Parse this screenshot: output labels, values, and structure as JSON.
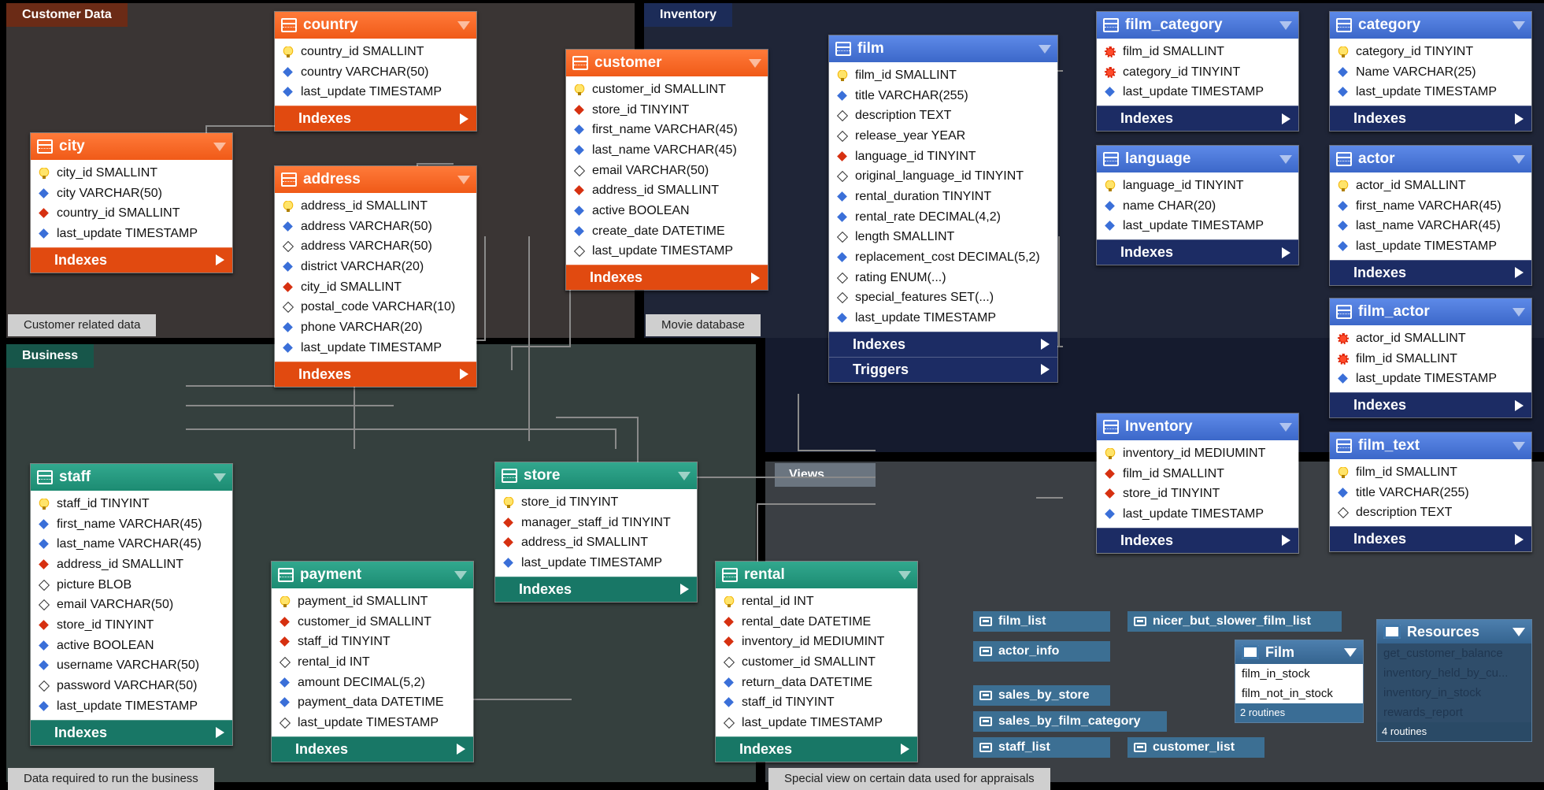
{
  "regions": {
    "customer": {
      "title": "Customer Data",
      "caption": "Customer related data"
    },
    "inventory": {
      "title": "Inventory",
      "caption": "Movie database"
    },
    "business": {
      "title": "Business",
      "caption": "Data required to run the business"
    },
    "views": {
      "title": "Views",
      "caption": "Special view on certain data used for appraisals"
    }
  },
  "tables": {
    "country": {
      "name": "country",
      "columns": [
        "country_id SMALLINT",
        "country VARCHAR(50)",
        "last_update TIMESTAMP"
      ],
      "sections": [
        "Indexes"
      ]
    },
    "city": {
      "name": "city",
      "columns": [
        "city_id SMALLINT",
        "city VARCHAR(50)",
        "country_id SMALLINT",
        "last_update TIMESTAMP"
      ],
      "sections": [
        "Indexes"
      ]
    },
    "address": {
      "name": "address",
      "columns": [
        "address_id SMALLINT",
        "address VARCHAR(50)",
        "address VARCHAR(50)",
        "district VARCHAR(20)",
        "city_id SMALLINT",
        "postal_code VARCHAR(10)",
        "phone VARCHAR(20)",
        "last_update TIMESTAMP"
      ],
      "sections": [
        "Indexes"
      ]
    },
    "customer": {
      "name": "customer",
      "columns": [
        "customer_id SMALLINT",
        "store_id TINYINT",
        "first_name VARCHAR(45)",
        "last_name VARCHAR(45)",
        "email VARCHAR(50)",
        "address_id SMALLINT",
        "active BOOLEAN",
        "create_date DATETIME",
        "last_update TIMESTAMP"
      ],
      "sections": [
        "Indexes"
      ]
    },
    "film": {
      "name": "film",
      "columns": [
        "film_id SMALLINT",
        "title VARCHAR(255)",
        "description TEXT",
        "release_year YEAR",
        "language_id TINYINT",
        "original_language_id TINYINT",
        "rental_duration TINYINT",
        "rental_rate DECIMAL(4,2)",
        "length SMALLINT",
        "replacement_cost DECIMAL(5,2)",
        "rating ENUM(...)",
        "special_features SET(...)",
        "last_update TIMESTAMP"
      ],
      "sections": [
        "Indexes",
        "Triggers"
      ]
    },
    "film_category": {
      "name": "film_category",
      "columns": [
        "film_id SMALLINT",
        "category_id TINYINT",
        "last_update TIMESTAMP"
      ],
      "sections": [
        "Indexes"
      ]
    },
    "category": {
      "name": "category",
      "columns": [
        "category_id TINYINT",
        "Name VARCHAR(25)",
        "last_update TIMESTAMP"
      ],
      "sections": [
        "Indexes"
      ]
    },
    "language": {
      "name": "language",
      "columns": [
        "language_id TINYINT",
        "name CHAR(20)",
        "last_update TIMESTAMP"
      ],
      "sections": [
        "Indexes"
      ]
    },
    "actor": {
      "name": "actor",
      "columns": [
        "actor_id SMALLINT",
        "first_name VARCHAR(45)",
        "last_name VARCHAR(45)",
        "last_update TIMESTAMP"
      ],
      "sections": [
        "Indexes"
      ]
    },
    "film_actor": {
      "name": "film_actor",
      "columns": [
        "actor_id SMALLINT",
        "film_id SMALLINT",
        "last_update TIMESTAMP"
      ],
      "sections": [
        "Indexes"
      ]
    },
    "inventory": {
      "name": "Inventory",
      "columns": [
        "inventory_id MEDIUMINT",
        "film_id SMALLINT",
        "store_id TINYINT",
        "last_update TIMESTAMP"
      ],
      "sections": [
        "Indexes"
      ]
    },
    "film_text": {
      "name": "film_text",
      "columns": [
        "film_id SMALLINT",
        "title VARCHAR(255)",
        "description TEXT"
      ],
      "sections": [
        "Indexes"
      ]
    },
    "staff": {
      "name": "staff",
      "columns": [
        "staff_id TINYINT",
        "first_name VARCHAR(45)",
        "last_name VARCHAR(45)",
        "address_id SMALLINT",
        "picture BLOB",
        "email VARCHAR(50)",
        "store_id TINYINT",
        "active BOOLEAN",
        "username VARCHAR(50)",
        "password VARCHAR(50)",
        "last_update TIMESTAMP"
      ],
      "sections": [
        "Indexes"
      ]
    },
    "store": {
      "name": "store",
      "columns": [
        "store_id TINYINT",
        "manager_staff_id TINYINT",
        "address_id SMALLINT",
        "last_update TIMESTAMP"
      ],
      "sections": [
        "Indexes"
      ]
    },
    "payment": {
      "name": "payment",
      "columns": [
        "payment_id SMALLINT",
        "customer_id SMALLINT",
        "staff_id TINYINT",
        "rental_id INT",
        "amount DECIMAL(5,2)",
        "payment_data DATETIME",
        "last_update TIMESTAMP"
      ],
      "sections": [
        "Indexes"
      ]
    },
    "rental": {
      "name": "rental",
      "columns": [
        "rental_id INT",
        "rental_date DATETIME",
        "inventory_id MEDIUMINT",
        "customer_id SMALLINT",
        "return_data DATETIME",
        "staff_id TINYINT",
        "last_update TIMESTAMP"
      ],
      "sections": [
        "Indexes"
      ]
    }
  },
  "views": [
    "film_list",
    "nicer_but_slower_film_list",
    "actor_info",
    "sales_by_store",
    "sales_by_film_category",
    "staff_list",
    "customer_list"
  ],
  "groups": {
    "film": {
      "name": "Film",
      "routines": [
        "film_in_stock",
        "film_not_in_stock"
      ],
      "count": "2 routines"
    },
    "resources": {
      "name": "Resources",
      "routines": [
        "get_customer_balance",
        "inventory_held_by_cu...",
        "inventory_in_stock",
        "rewards_report"
      ],
      "count": "4 routines"
    }
  }
}
